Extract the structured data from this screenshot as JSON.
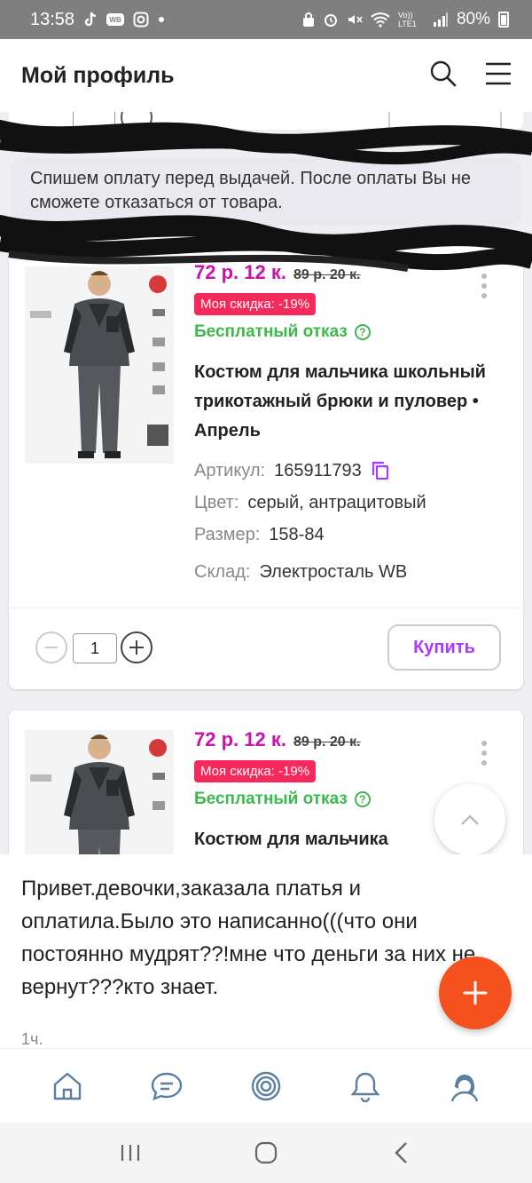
{
  "status_bar": {
    "time": "13:58",
    "battery": "80%",
    "network": "Vo)) LTE1"
  },
  "header": {
    "title": "Мой профиль"
  },
  "screenshot": {
    "notice": "Спишем оплату перед выдачей. После оплаты Вы не сможете отказаться от товара.",
    "products": [
      {
        "price": "72 р. 12 к.",
        "old_price": "89 р. 20 к.",
        "discount": "Моя скидка: -19%",
        "free_return": "Бесплатный отказ",
        "title": "Костюм для мальчика школьный трикотажный брюки и пуловер • Апрель",
        "article_label": "Артикул:",
        "article": "165911793",
        "color_label": "Цвет:",
        "color": "серый, антрацитовый",
        "size_label": "Размер:",
        "size": "158-84",
        "warehouse_label": "Склад:",
        "warehouse": "Электросталь WB",
        "quantity": "1",
        "buy_label": "Купить"
      },
      {
        "price": "72 р. 12 к.",
        "old_price": "89 р. 20 к.",
        "discount": "Моя скидка: -19%",
        "free_return": "Бесплатный отказ",
        "title": "Костюм для мальчика"
      }
    ]
  },
  "post": {
    "text": "Привет.девочки,заказала платья и оплатила.Было это написанно(((что они постоянно мудрят??!мне что деньги за них не вернут???кто знает.",
    "time": "1ч."
  },
  "colors": {
    "price": "#cb11ab",
    "discount_bg": "#f5295c",
    "free_return": "#3db84e",
    "buy_text": "#a73afd",
    "fab": "#f4511e"
  },
  "icons": {
    "header": [
      "search-icon",
      "menu-icon"
    ],
    "bottom_nav": [
      "home-icon",
      "chat-icon",
      "target-icon",
      "bell-icon",
      "profile-icon"
    ],
    "system_nav": [
      "recents-icon",
      "home-circle-icon",
      "back-icon"
    ]
  }
}
